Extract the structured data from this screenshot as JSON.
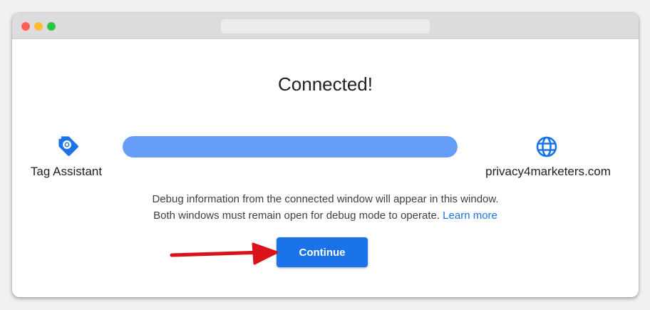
{
  "window": {
    "controls": [
      "close",
      "minimize",
      "zoom"
    ]
  },
  "main": {
    "title": "Connected!",
    "source": {
      "label": "Tag Assistant",
      "icon": "tag-assistant-icon"
    },
    "destination": {
      "label": "privacy4marketers.com",
      "icon": "globe-icon"
    },
    "progress": {
      "fraction": 1.0
    },
    "info": {
      "line1": "Debug information from the connected window will appear in this window.",
      "line2": "Both windows must remain open for debug mode to operate.",
      "link_label": "Learn more"
    },
    "continue_label": "Continue"
  },
  "annotation": {
    "icon": "red-arrow-icon",
    "color": "#d9121c"
  },
  "colors": {
    "accent": "#1a73e8",
    "progress": "#669df6",
    "title_bar": "#dcdcdf"
  }
}
